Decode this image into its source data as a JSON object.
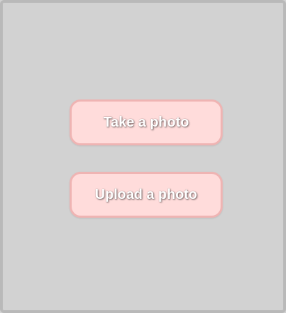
{
  "actions": {
    "take_photo_label": "Take a photo",
    "upload_photo_label": "Upload a photo"
  },
  "colors": {
    "background": "#d2d2d2",
    "frame_border": "#b9b9b9",
    "button_fill": "#ffdcdb",
    "button_border": "#efb4b3",
    "button_text": "#ffffff"
  }
}
